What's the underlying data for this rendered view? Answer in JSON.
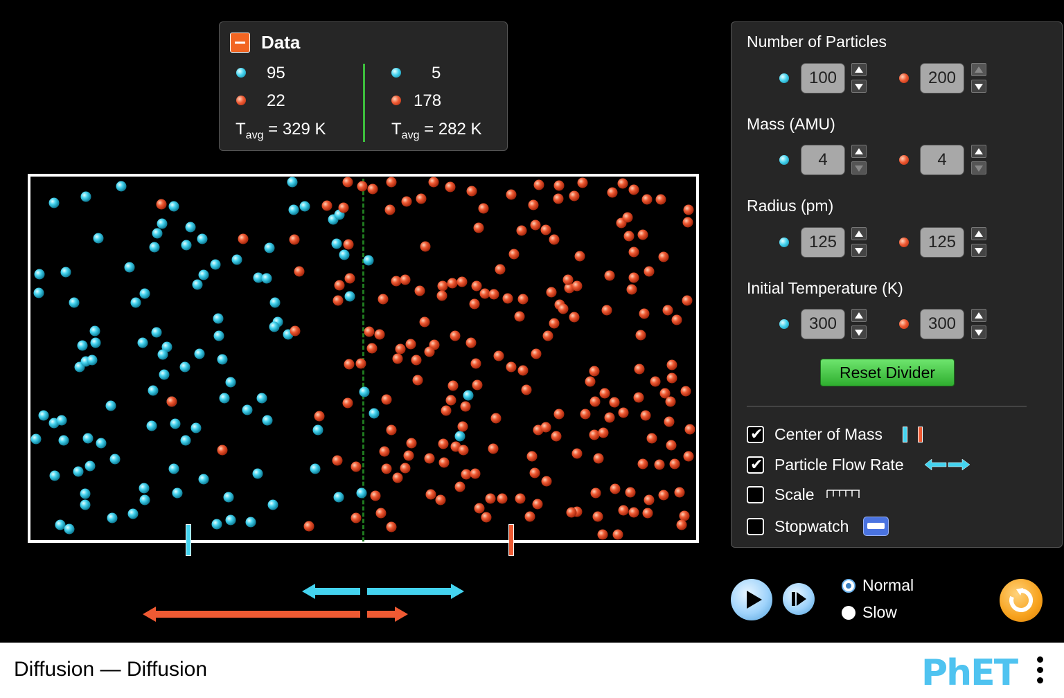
{
  "data_panel": {
    "title": "Data",
    "left": {
      "cyan_count": "95",
      "red_count": "22",
      "tavg_label": "T",
      "tavg_sub": "avg",
      "tavg_value": " = 329 K"
    },
    "right": {
      "cyan_count": "5",
      "red_count": "178",
      "tavg_label": "T",
      "tavg_sub": "avg",
      "tavg_value": " = 282 K"
    }
  },
  "controls": {
    "number_of_particles": {
      "title": "Number of Particles",
      "cyan": "100",
      "red": "200"
    },
    "mass": {
      "title": "Mass (AMU)",
      "cyan": "4",
      "red": "4"
    },
    "radius": {
      "title": "Radius (pm)",
      "cyan": "125",
      "red": "125"
    },
    "initial_temperature": {
      "title": "Initial Temperature (K)",
      "cyan": "300",
      "red": "300"
    },
    "reset_divider": "Reset Divider",
    "checkboxes": [
      {
        "label": "Center of Mass",
        "checked": true
      },
      {
        "label": "Particle Flow Rate",
        "checked": true
      },
      {
        "label": "Scale",
        "checked": false
      },
      {
        "label": "Stopwatch",
        "checked": false
      }
    ]
  },
  "playback": {
    "speed_options": [
      "Normal",
      "Slow"
    ],
    "selected_speed": "Normal"
  },
  "footer": {
    "title": "Diffusion — Diffusion",
    "logo": "PhET"
  },
  "colors": {
    "cyan": "#44d3ef",
    "red": "#ef5a33",
    "divider": "#1f7a1f",
    "accent_green": "#3cbd3c"
  },
  "icons": [
    "collapse-icon",
    "play-icon",
    "step-icon",
    "reset-all-icon",
    "menu-icon",
    "stopwatch-icon",
    "scale-icon",
    "flow-rate-icon",
    "center-of-mass-icon"
  ]
}
